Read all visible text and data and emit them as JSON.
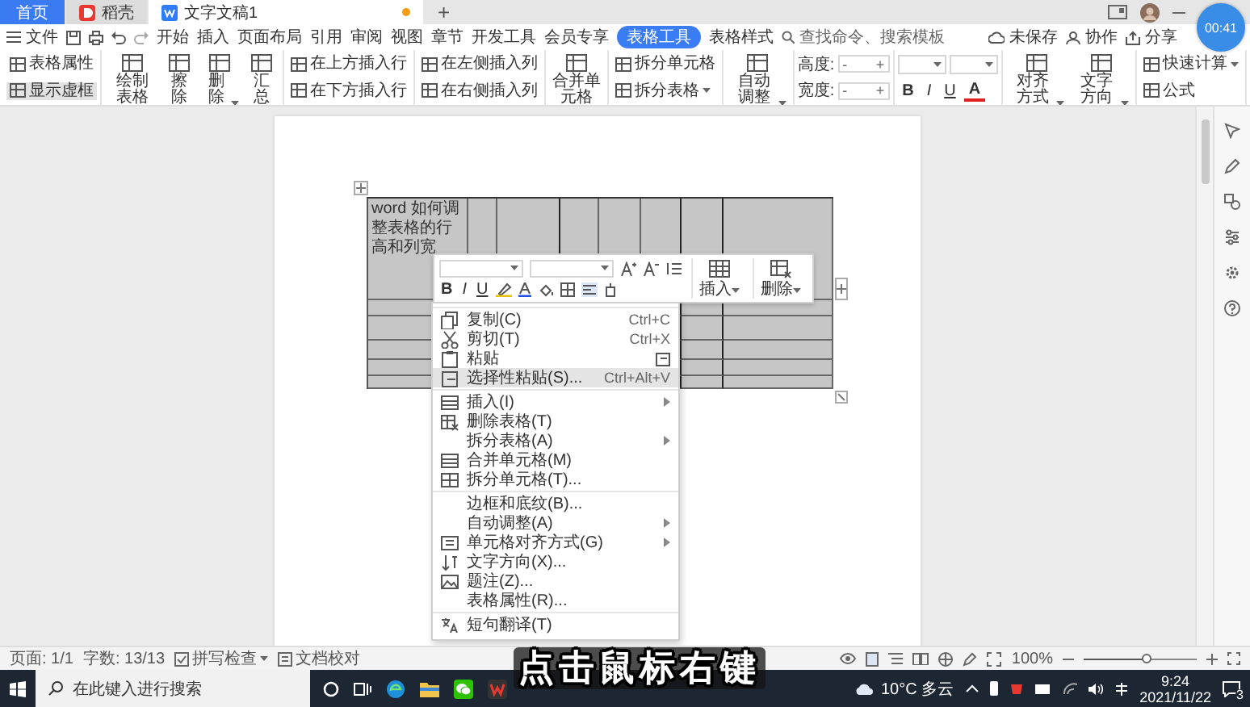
{
  "app_tabs": [
    {
      "label": "首页",
      "kind": "home",
      "selected": false
    },
    {
      "label": "稻壳",
      "kind": "store",
      "selected": false
    },
    {
      "label": "文字文稿1",
      "kind": "doc",
      "selected": true
    }
  ],
  "new_tab": "+",
  "timer": "00:41",
  "file_menu": "文件",
  "ribbon_tabs": [
    {
      "label": "开始",
      "selected": false
    },
    {
      "label": "插入",
      "selected": false
    },
    {
      "label": "页面布局",
      "selected": false
    },
    {
      "label": "引用",
      "selected": false
    },
    {
      "label": "审阅",
      "selected": false
    },
    {
      "label": "视图",
      "selected": false
    },
    {
      "label": "章节",
      "selected": false
    },
    {
      "label": "开发工具",
      "selected": false
    },
    {
      "label": "会员专享",
      "selected": false
    },
    {
      "label": "表格工具",
      "selected": true
    },
    {
      "label": "表格样式",
      "selected": false
    }
  ],
  "search": {
    "placeholder": "查找命令、搜索模板"
  },
  "header_actions": [
    "未保存",
    "协作",
    "分享"
  ],
  "ribbon": [
    {
      "kind": "stack",
      "items": [
        {
          "kind": "small",
          "label": "表格属性",
          "on": false
        },
        {
          "kind": "small",
          "label": "显示虚框",
          "on": true
        }
      ]
    },
    {
      "kind": "row",
      "items": [
        {
          "kind": "big",
          "label": "绘制表格",
          "dropdown": false
        },
        {
          "kind": "big",
          "label": "擦除",
          "dropdown": false
        },
        {
          "kind": "big",
          "label": "删除",
          "dropdown": true
        },
        {
          "kind": "big",
          "label": "汇总",
          "dropdown": false
        }
      ]
    },
    {
      "kind": "stack",
      "items": [
        {
          "kind": "small",
          "label": "在上方插入行"
        },
        {
          "kind": "small",
          "label": "在下方插入行"
        }
      ]
    },
    {
      "kind": "stack",
      "items": [
        {
          "kind": "small",
          "label": "在左侧插入列"
        },
        {
          "kind": "small",
          "label": "在右侧插入列"
        }
      ]
    },
    {
      "kind": "row",
      "items": [
        {
          "kind": "big",
          "label": "合并单元格",
          "dropdown": false
        }
      ]
    },
    {
      "kind": "stack",
      "items": [
        {
          "kind": "small",
          "label": "拆分单元格"
        },
        {
          "kind": "small",
          "label": "拆分表格",
          "dropdown": true
        }
      ]
    },
    {
      "kind": "row",
      "items": [
        {
          "kind": "big",
          "label": "自动调整",
          "dropdown": true
        }
      ]
    },
    {
      "kind": "stack",
      "items": [
        {
          "kind": "size_field",
          "label": "高度:",
          "decrement": "-",
          "increment": "+"
        },
        {
          "kind": "size_field",
          "label": "宽度:",
          "decrement": "-",
          "increment": "+"
        }
      ]
    },
    {
      "kind": "format",
      "items": [
        {
          "kind": "font_box"
        },
        {
          "kind": "font_box"
        },
        {
          "kind": "format",
          "label": "B"
        },
        {
          "kind": "format",
          "label": "I"
        },
        {
          "kind": "format",
          "label": "U"
        },
        {
          "kind": "format",
          "label": "A"
        }
      ]
    },
    {
      "kind": "row",
      "items": [
        {
          "kind": "big",
          "label": "对齐方式",
          "dropdown": true
        },
        {
          "kind": "big",
          "label": "文字方向",
          "dropdown": true
        }
      ]
    },
    {
      "kind": "stack",
      "items": [
        {
          "kind": "small",
          "label": "快速计算",
          "dropdown": true
        },
        {
          "kind": "small",
          "label": "公式"
        }
      ]
    }
  ],
  "document": {
    "cell_text": "word 如何调整表格的行高和列宽"
  },
  "mini_toolbar": {
    "format": [
      "B",
      "I",
      "U"
    ],
    "actions": [
      {
        "label": "插入"
      },
      {
        "label": "删除"
      }
    ]
  },
  "context_menu": {
    "sections": [
      {
        "items": [
          {
            "label": "复制(C)",
            "shortcut": "Ctrl+C",
            "selected": false,
            "submenu": false
          },
          {
            "label": "剪切(T)",
            "shortcut": "Ctrl+X",
            "selected": false,
            "submenu": false
          },
          {
            "label": "粘贴",
            "selected": false,
            "submenu": false
          },
          {
            "label": "选择性粘贴(S)...",
            "shortcut": "Ctrl+Alt+V",
            "selected": true,
            "submenu": false
          }
        ]
      },
      {
        "items": [
          {
            "label": "插入(I)",
            "selected": false,
            "submenu": true
          },
          {
            "label": "删除表格(T)",
            "selected": false,
            "submenu": false
          },
          {
            "label": "拆分表格(A)",
            "selected": false,
            "submenu": true
          },
          {
            "label": "合并单元格(M)",
            "selected": false,
            "submenu": false
          },
          {
            "label": "拆分单元格(T)...",
            "selected": false,
            "submenu": false
          }
        ]
      },
      {
        "items": [
          {
            "label": "边框和底纹(B)...",
            "selected": false,
            "submenu": false
          },
          {
            "label": "自动调整(A)",
            "selected": false,
            "submenu": true
          },
          {
            "label": "单元格对齐方式(G)",
            "selected": false,
            "submenu": true
          },
          {
            "label": "文字方向(X)...",
            "selected": false,
            "submenu": false
          },
          {
            "label": "题注(Z)...",
            "selected": false,
            "submenu": false
          },
          {
            "label": "表格属性(R)...",
            "selected": false,
            "submenu": false
          }
        ]
      },
      {
        "items": [
          {
            "label": "短句翻译(T)",
            "selected": false,
            "submenu": false
          }
        ]
      }
    ]
  },
  "status_bar": {
    "items": [
      "页面: 1/1",
      "字数: 13/13",
      "拼写检查",
      "文档校对"
    ],
    "zoom": "100%",
    "level": 0.55
  },
  "taskbar": {
    "search": {
      "placeholder": "在此键入进行搜索"
    },
    "weather": "10°C 多云",
    "time": "9:24",
    "date": "2021/11/22",
    "notifications": "3"
  },
  "caption": "点击鼠标右键"
}
